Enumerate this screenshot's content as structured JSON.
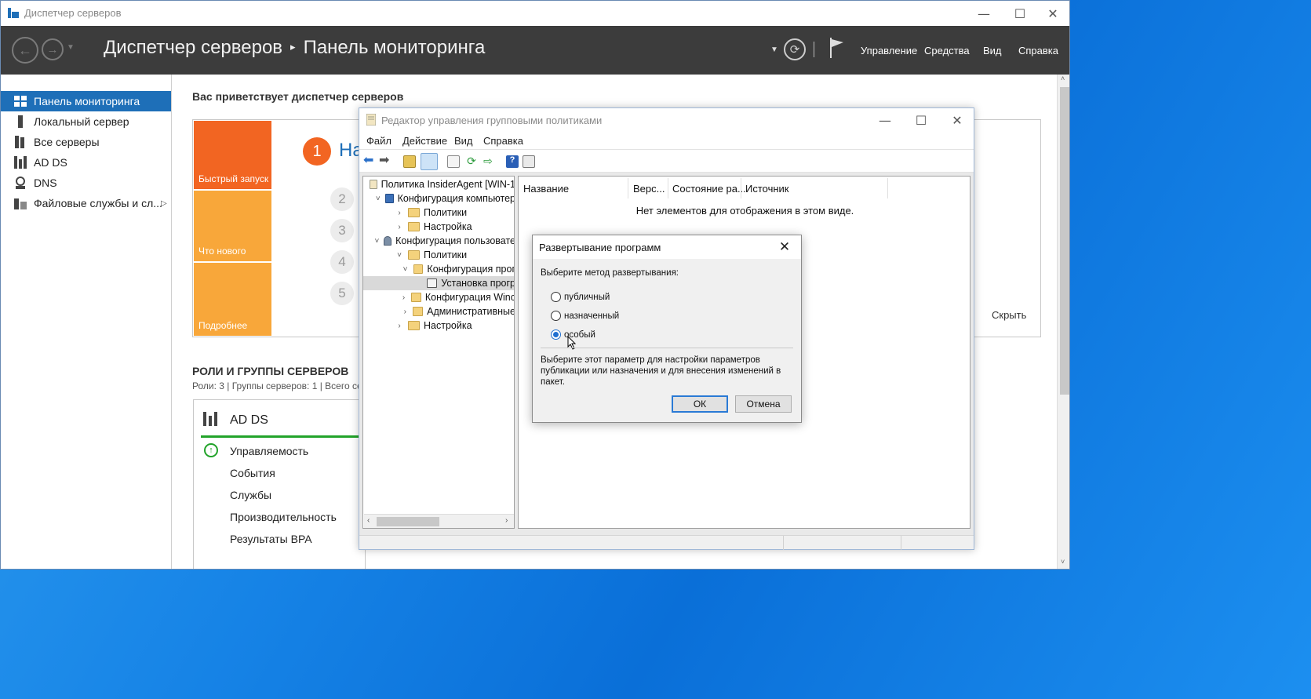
{
  "sm": {
    "window_title": "Диспетчер серверов",
    "breadcrumb_root": "Диспетчер серверов",
    "breadcrumb_sep": "▸",
    "breadcrumb_current": "Панель мониторинга",
    "menu": [
      "Управление",
      "Средства",
      "Вид",
      "Справка"
    ],
    "sidebar": [
      {
        "label": "Панель мониторинга",
        "icon": "dashboard-icon",
        "active": true
      },
      {
        "label": "Локальный сервер",
        "icon": "server-icon"
      },
      {
        "label": "Все серверы",
        "icon": "servers-icon"
      },
      {
        "label": "AD DS",
        "icon": "ad-ds-icon"
      },
      {
        "label": "DNS",
        "icon": "dns-icon"
      },
      {
        "label": "Файловые службы и сл...",
        "icon": "file-services-icon"
      }
    ],
    "welcome": "Вас приветствует диспетчер серверов",
    "tiles": [
      "Быстрый запуск",
      "Что нового",
      "Подробнее"
    ],
    "steps": [
      "1",
      "2",
      "3",
      "4",
      "5"
    ],
    "step1_text": "На",
    "hide": "Скрыть",
    "roles_title": "РОЛИ И ГРУППЫ СЕРВЕРОВ",
    "roles_sub": "Роли: 3 | Группы серверов: 1 | Всего се",
    "adds_title": "AD DS",
    "adds_items": [
      "Управляемость",
      "События",
      "Службы",
      "Производительность",
      "Результаты BPA"
    ]
  },
  "gpo": {
    "title": "Редактор управления групповыми политиками",
    "menu": [
      "Файл",
      "Действие",
      "Вид",
      "Справка"
    ],
    "tree": [
      {
        "label": "Политика InsiderAgent [WIN-1",
        "level": 0,
        "chev": "",
        "icon": "policy"
      },
      {
        "label": "Конфигурация компьютер",
        "level": 1,
        "chev": "˅",
        "icon": "computer"
      },
      {
        "label": "Политики",
        "level": 2,
        "chev": "›",
        "icon": "folder"
      },
      {
        "label": "Настройка",
        "level": 2,
        "chev": "›",
        "icon": "folder"
      },
      {
        "label": "Конфигурация пользовате",
        "level": 1,
        "chev": "˅",
        "icon": "user"
      },
      {
        "label": "Политики",
        "level": 2,
        "chev": "˅",
        "icon": "folder"
      },
      {
        "label": "Конфигурация прог",
        "level": 3,
        "chev": "˅",
        "icon": "folder"
      },
      {
        "label": "Установка прогр",
        "level": 4,
        "chev": "",
        "icon": "install",
        "selected": true
      },
      {
        "label": "Конфигурация Winc",
        "level": 3,
        "chev": "›",
        "icon": "folder"
      },
      {
        "label": "Административные",
        "level": 3,
        "chev": "›",
        "icon": "folder"
      },
      {
        "label": "Настройка",
        "level": 2,
        "chev": "›",
        "icon": "folder"
      }
    ],
    "columns": [
      "Название",
      "Верс...",
      "Состояние ра...",
      "Источник"
    ],
    "empty": "Нет элементов для отображения в этом виде."
  },
  "dialog": {
    "title": "Развертывание программ",
    "prompt": "Выберите метод развертывания:",
    "options": [
      {
        "label": "публичный",
        "selected": false
      },
      {
        "label": "назначенный",
        "selected": false
      },
      {
        "label": "особый",
        "selected": true
      }
    ],
    "description_lines": [
      "Выберите этот параметр для настройки параметров",
      "публикации или назначения и для внесения изменений в",
      "пакет."
    ],
    "ok": "ОК",
    "cancel": "Отмена"
  },
  "colors": {
    "accent": "#1e6fb8",
    "tile_orange": "#f26522",
    "tile_light": "#f8a73a",
    "header_bg": "#3c3c3c",
    "desktop": "#1683e6"
  }
}
